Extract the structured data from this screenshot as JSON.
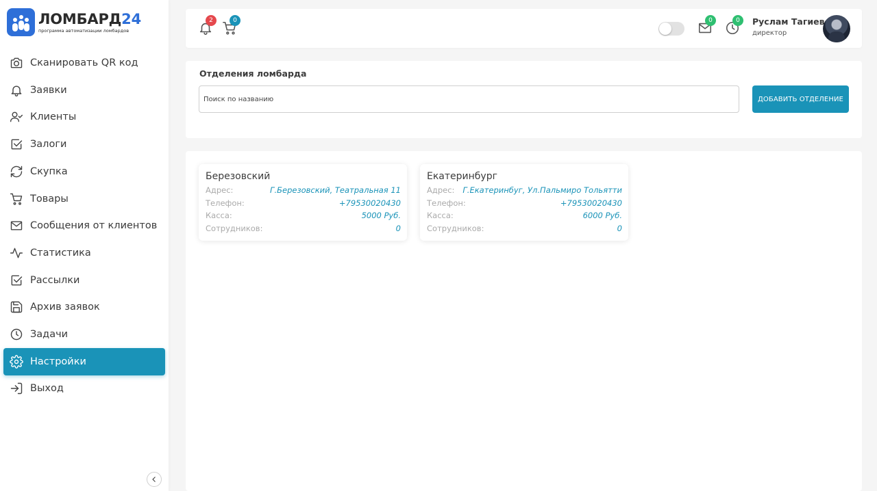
{
  "brand": {
    "name_main": "ЛОМБАРД",
    "name_num": "24",
    "subtitle": "программа автоматизации ломбардов",
    "accent": "#2e6fd8"
  },
  "sidebar": {
    "items": [
      {
        "label": "Сканировать QR код",
        "icon": "camera-icon"
      },
      {
        "label": "Заявки",
        "icon": "bell-icon"
      },
      {
        "label": "Клиенты",
        "icon": "user-check-icon"
      },
      {
        "label": "Залоги",
        "icon": "checkbox-icon"
      },
      {
        "label": "Скупка",
        "icon": "refresh-icon"
      },
      {
        "label": "Товары",
        "icon": "cart-icon"
      },
      {
        "label": "Сообщения от клиентов",
        "icon": "mail-icon"
      },
      {
        "label": "Статистика",
        "icon": "activity-icon"
      },
      {
        "label": "Рассылки",
        "icon": "checkbox-icon"
      },
      {
        "label": "Архив заявок",
        "icon": "save-icon"
      },
      {
        "label": "Задачи",
        "icon": "clock-icon"
      },
      {
        "label": "Настройки",
        "icon": "gear-icon",
        "active": true
      },
      {
        "label": "Выход",
        "icon": "logout-icon"
      }
    ],
    "active_color": "#1a93b8"
  },
  "header": {
    "notifications_count": "2",
    "cart_count": "0",
    "messages_count": "0",
    "tasks_count": "0",
    "user_name": "Руслам Тагиев",
    "user_role": "директор"
  },
  "branches": {
    "title": "Отделения ломбарда",
    "search_placeholder": "Поиск по названию",
    "add_button": "ДОБАВИТЬ ОТДЕЛЕНИЕ",
    "labels": {
      "address": "Адрес:",
      "phone": "Телефон:",
      "cash": "Касса:",
      "staff": "Сотрудников:"
    },
    "items": [
      {
        "name": "Березовский",
        "address": "Г.Березовский, Театральная 11",
        "phone": "+79530020430",
        "cash": "5000 Руб.",
        "staff": "0"
      },
      {
        "name": "Екатеринбург",
        "address": "Г.Екатеринбуг, Ул.Пальмиро Тольятти",
        "phone": "+79530020430",
        "cash": "6000 Руб.",
        "staff": "0"
      }
    ]
  }
}
